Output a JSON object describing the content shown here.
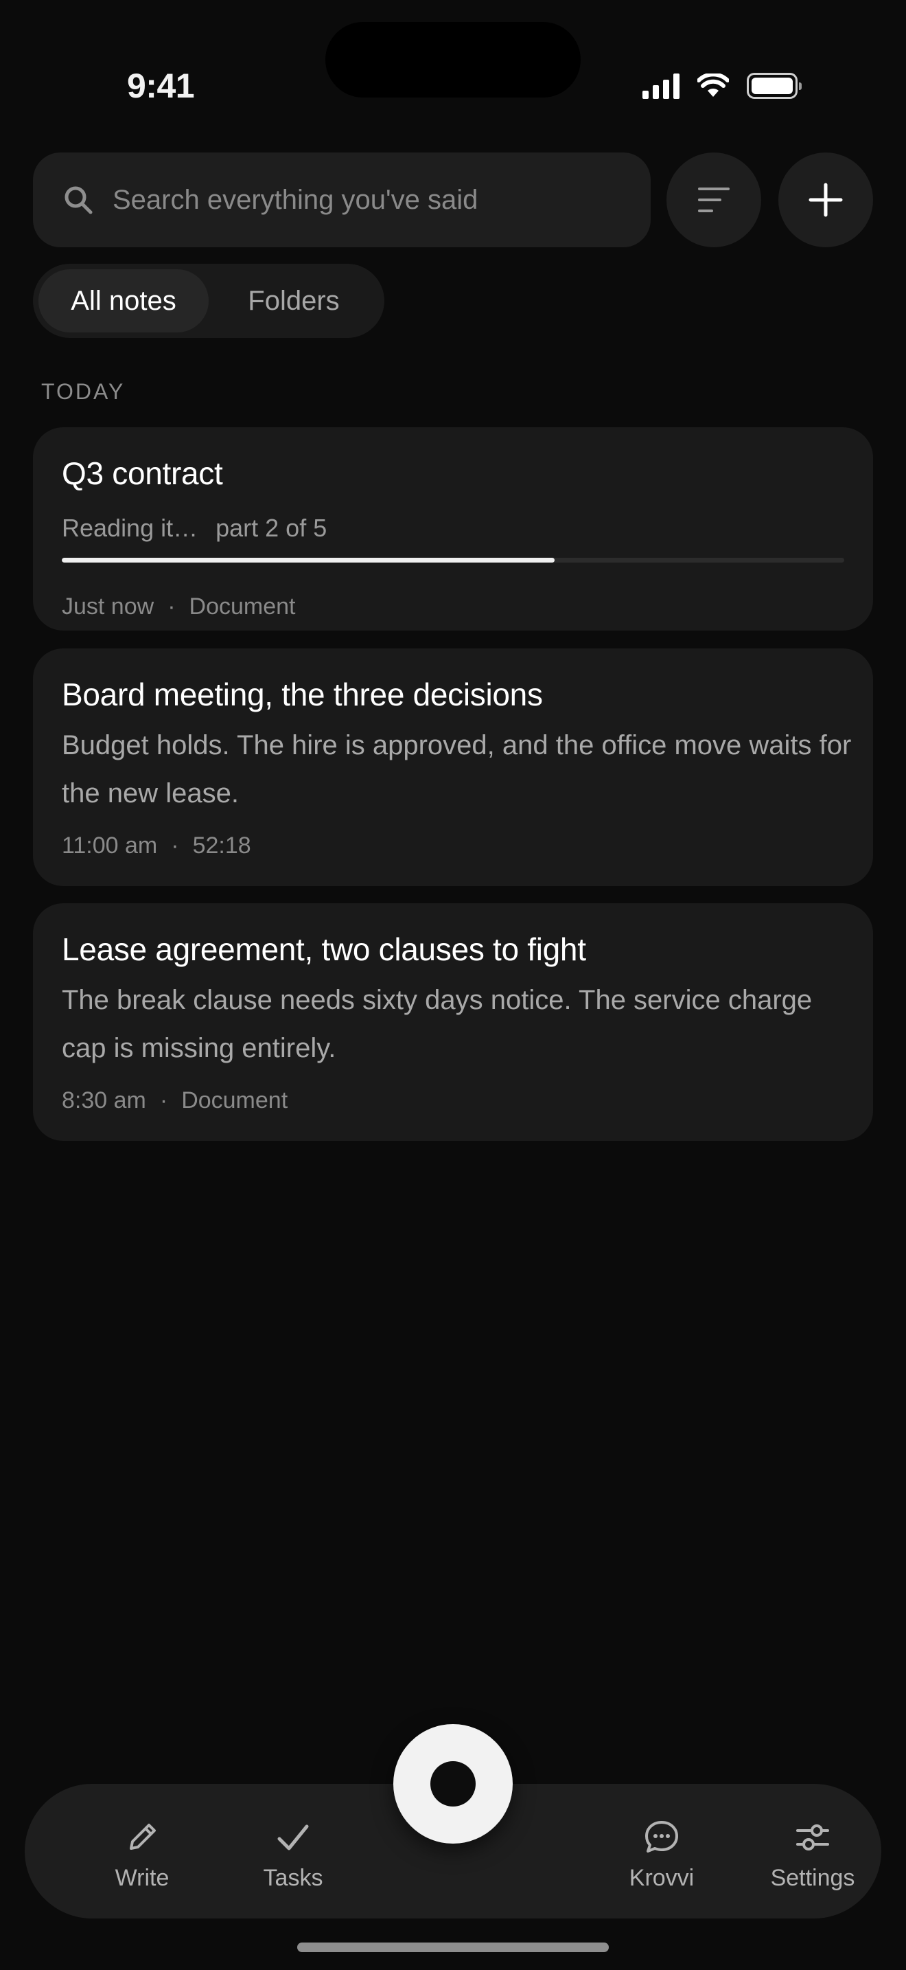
{
  "status_bar": {
    "time": "9:41"
  },
  "search": {
    "placeholder": "Search everything you've said",
    "value": ""
  },
  "tabs_segment": [
    {
      "label": "All notes",
      "active": true
    },
    {
      "label": "Folders",
      "active": false
    }
  ],
  "section": {
    "label": "TODAY"
  },
  "notes": [
    {
      "title": "Q3 contract",
      "status": "Reading it…",
      "part": "part 2 of 5",
      "progress": 0.63,
      "time": "Just now",
      "kind": "Document"
    },
    {
      "title": "Board meeting, the three decisions",
      "snippet": "Budget holds. The hire is approved, and the office move waits for the new lease.",
      "time": "11:00 am",
      "kind": "52:18"
    },
    {
      "title": "Lease agreement, two clauses to fight",
      "snippet": "The break clause needs sixty days notice. The service charge cap is missing entirely.",
      "time": "8:30 am",
      "kind": "Document"
    }
  ],
  "meta_separator": "·",
  "nav": {
    "write": "Write",
    "tasks": "Tasks",
    "krovvi": "Krovvi",
    "settings": "Settings"
  },
  "icons": [
    "search-icon",
    "filter-icon",
    "plus-icon",
    "pencil-icon",
    "check-icon",
    "chat-bubble-icon",
    "sliders-icon",
    "record-icon"
  ]
}
